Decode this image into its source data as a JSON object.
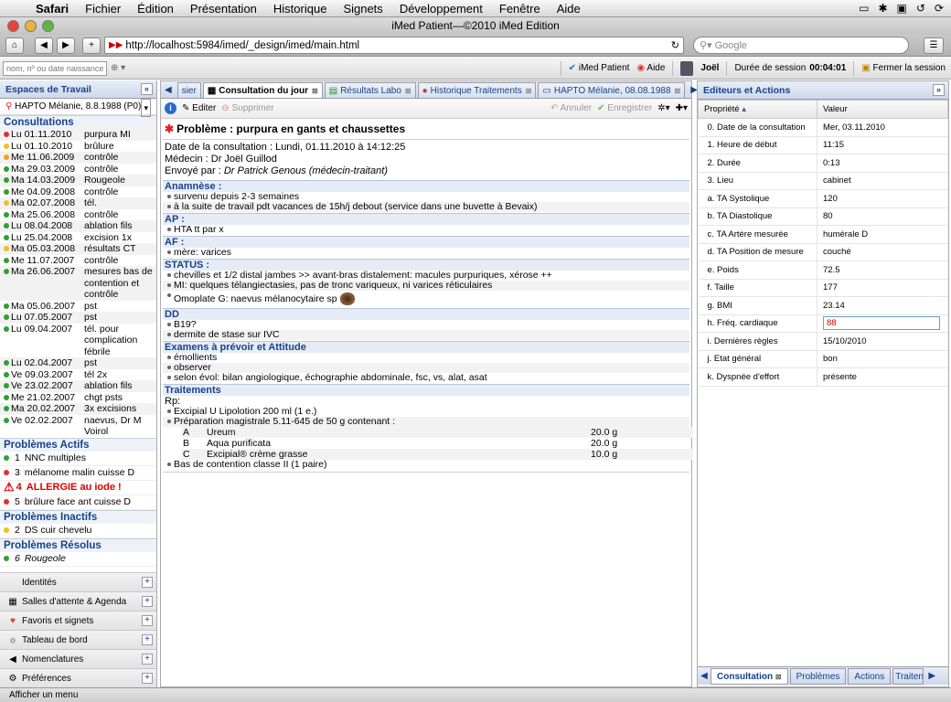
{
  "menubar": {
    "app": "Safari",
    "items": [
      "Fichier",
      "Édition",
      "Présentation",
      "Historique",
      "Signets",
      "Développement",
      "Fenêtre",
      "Aide"
    ]
  },
  "window": {
    "title": "iMed Patient—©2010 iMed Edition"
  },
  "browser": {
    "url": "http://localhost:5984/imed/_design/imed/main.html",
    "search_placeholder": "Google"
  },
  "appbar": {
    "patient_search_placeholder": "nom, nº ou date naissance",
    "brand": "iMed Patient",
    "help": "Aide",
    "user": "Joël",
    "session_label": "Durée de session",
    "session_time": "00:04:01",
    "close_session": "Fermer la session"
  },
  "left": {
    "title": "Espaces de Travail",
    "patient": "HAPTO Mélanie, 8.8.1988 (P0)",
    "consultations_title": "Consultations",
    "consultations": [
      {
        "date": "Lu 01.11.2010",
        "text": "purpura MI",
        "color": "#e03030"
      },
      {
        "date": "Lu 01.10.2010",
        "text": "brûlure",
        "color": "#f0c020"
      },
      {
        "date": "Me 11.06.2009",
        "text": "contrôle",
        "color": "#f0a020"
      },
      {
        "date": "Ma 29.03.2009",
        "text": "contrôle",
        "color": "#30a030"
      },
      {
        "date": "Ma 14.03.2009",
        "text": "Rougeole",
        "color": "#30a030"
      },
      {
        "date": "Me 04.09.2008",
        "text": "contrôle",
        "color": "#30a030"
      },
      {
        "date": "Ma 02.07.2008",
        "text": "tél.",
        "color": "#f0c020"
      },
      {
        "date": "Ma 25.06.2008",
        "text": "contrôle",
        "color": "#30a030"
      },
      {
        "date": "Lu 08.04.2008",
        "text": "ablation fils",
        "color": "#30a030"
      },
      {
        "date": "Lu 25.04.2008",
        "text": "excision 1x",
        "color": "#30a030"
      },
      {
        "date": "Ma 05.03.2008",
        "text": "résultats CT",
        "color": "#f0c020"
      },
      {
        "date": "Me 11.07.2007",
        "text": "contrôle",
        "color": "#30a030"
      },
      {
        "date": "Ma 26.06.2007",
        "text": "mesures bas de contention et contrôle",
        "color": "#30a030"
      },
      {
        "date": "Ma 05.06.2007",
        "text": "pst",
        "color": "#30a030"
      },
      {
        "date": "Lu 07.05.2007",
        "text": "pst",
        "color": "#30a030"
      },
      {
        "date": "Lu 09.04.2007",
        "text": "tél. pour complication fébrile",
        "color": "#30a030"
      },
      {
        "date": "Lu 02.04.2007",
        "text": "pst",
        "color": "#30a030"
      },
      {
        "date": "Ve 09.03.2007",
        "text": "tél 2x",
        "color": "#30a030"
      },
      {
        "date": "Ve 23.02.2007",
        "text": "ablation fils",
        "color": "#30a030"
      },
      {
        "date": "Me 21.02.2007",
        "text": "chgt psts",
        "color": "#30a030"
      },
      {
        "date": "Ma 20.02.2007",
        "text": "3x excisions",
        "color": "#30a030"
      },
      {
        "date": "Ve 02.02.2007",
        "text": "naevus, Dr M Voirol",
        "color": "#30a030"
      }
    ],
    "active_title": "Problèmes Actifs",
    "active": [
      {
        "n": "1",
        "text": "NNC multiples",
        "color": "#30a030",
        "alert": false
      },
      {
        "n": "3",
        "text": "mélanome malin cuisse D",
        "color": "#e03030",
        "alert": false
      },
      {
        "n": "4",
        "text": "ALLERGIE au iode !",
        "color": "#e03030",
        "alert": true
      },
      {
        "n": "5",
        "text": "brûlure face ant cuisse D",
        "color": "#e03030",
        "alert": false
      }
    ],
    "inactive_title": "Problèmes Inactifs",
    "inactive": [
      {
        "n": "2",
        "text": "DS cuir chevelu",
        "color": "#f0c020"
      }
    ],
    "resolved_title": "Problèmes Résolus",
    "resolved": [
      {
        "n": "6",
        "text": "Rougeole",
        "color": "#30a030"
      }
    ],
    "accordion": [
      {
        "label": "Identités",
        "icon": ""
      },
      {
        "label": "Salles d'attente & Agenda",
        "icon": "calendar-icon"
      },
      {
        "label": "Favoris et signets",
        "icon": "heart-icon"
      },
      {
        "label": "Tableau de bord",
        "icon": "dashboard-icon"
      },
      {
        "label": "Nomenclatures",
        "icon": "horn-icon"
      },
      {
        "label": "Préférences",
        "icon": "settings-icon"
      }
    ]
  },
  "center": {
    "tabs": [
      {
        "label": "sier",
        "active": false
      },
      {
        "label": "Consultation du jour",
        "active": true
      },
      {
        "label": "Résultats Labo",
        "active": false
      },
      {
        "label": "Historique Traitements",
        "active": false
      },
      {
        "label": "HAPTO Mélanie, 08.08.1988",
        "active": false
      }
    ],
    "toolbar": {
      "edit": "Editer",
      "delete": "Supprimer",
      "cancel": "Annuler",
      "save": "Enregistrer"
    },
    "problem": "Problème : purpura en gants et chaussettes",
    "date_line": "Date de la consultation : Lundi, 01.11.2010 à 14:12:25",
    "doctor_line": "Médecin : Dr Joël Guillod",
    "sent_by_label": "Envoyé par :",
    "sent_by": "Dr Patrick Genous (médecin-traitant)",
    "sections": [
      {
        "title": "Anamnèse :",
        "items": [
          "survenu depuis 2-3 semaines",
          "à la suite de travail pdt vacances de 15h/j debout (service dans une buvette à Bevaix)"
        ]
      },
      {
        "title": "AP :",
        "items": [
          "HTA tt par x"
        ]
      },
      {
        "title": "AF :",
        "items": [
          "mère: varices"
        ]
      },
      {
        "title": "STATUS :",
        "items": [
          "chevilles et 1/2 distal jambes >> avant-bras distalement: macules purpuriques, xérose ++",
          "MI: quelques télangiectasies, pas de tronc variqueux, ni varices réticulaires",
          "Omoplate G: naevus mélanocytaire sp"
        ]
      },
      {
        "title": "DD",
        "items": [
          "B19?",
          "dermite de stase sur IVC"
        ]
      },
      {
        "title": "Examens à prévoir et Attitude",
        "items": [
          "émollients",
          "observer",
          "selon évol: bilan angiologique, échographie abdominale, fsc, vs, alat, asat"
        ]
      }
    ],
    "treatments_title": "Traitements",
    "rp": "Rp:",
    "rx1": "Excipial U Lipolotion 200 ml (1 e.)",
    "rx2": "Préparation magistrale 5.11-645 de 50 g contenant :",
    "rx_rows": [
      {
        "k": "A",
        "name": "Ureum",
        "qty": "20.0 g"
      },
      {
        "k": "B",
        "name": "Aqua purificata",
        "qty": "20.0 g"
      },
      {
        "k": "C",
        "name": "Excipial® crème grasse",
        "qty": "10.0 g"
      }
    ],
    "rx3": "Bas de contention classe II (1 paire)"
  },
  "right": {
    "title": "Editeurs et Actions",
    "col_prop": "Propriété",
    "col_val": "Valeur",
    "props": [
      {
        "k": "0. Date de la consultation",
        "v": "Mer, 03.11.2010"
      },
      {
        "k": "1. Heure de début",
        "v": "11:15"
      },
      {
        "k": "2. Durée",
        "v": "0:13"
      },
      {
        "k": "3. Lieu",
        "v": "cabinet"
      },
      {
        "k": "a. TA Systolique",
        "v": "120"
      },
      {
        "k": "b. TA Diastolique",
        "v": "80"
      },
      {
        "k": "c. TA Artère mesurée",
        "v": "humérale D"
      },
      {
        "k": "d. TA Position de mesure",
        "v": "couché"
      },
      {
        "k": "e. Poids",
        "v": "72.5"
      },
      {
        "k": "f. Taille",
        "v": "177"
      },
      {
        "k": "g. BMI",
        "v": "23.14"
      },
      {
        "k": "h. Fréq. cardiaque",
        "v": "88"
      },
      {
        "k": "i. Dernières règles",
        "v": "15/10/2010"
      },
      {
        "k": "j. Etat général",
        "v": "bon"
      },
      {
        "k": "k. Dyspnée d'effort",
        "v": "présente"
      }
    ],
    "tabs": [
      "Consultation",
      "Problèmes",
      "Actions",
      "Traiten"
    ]
  },
  "statusbar": {
    "text": "Afficher un menu"
  }
}
